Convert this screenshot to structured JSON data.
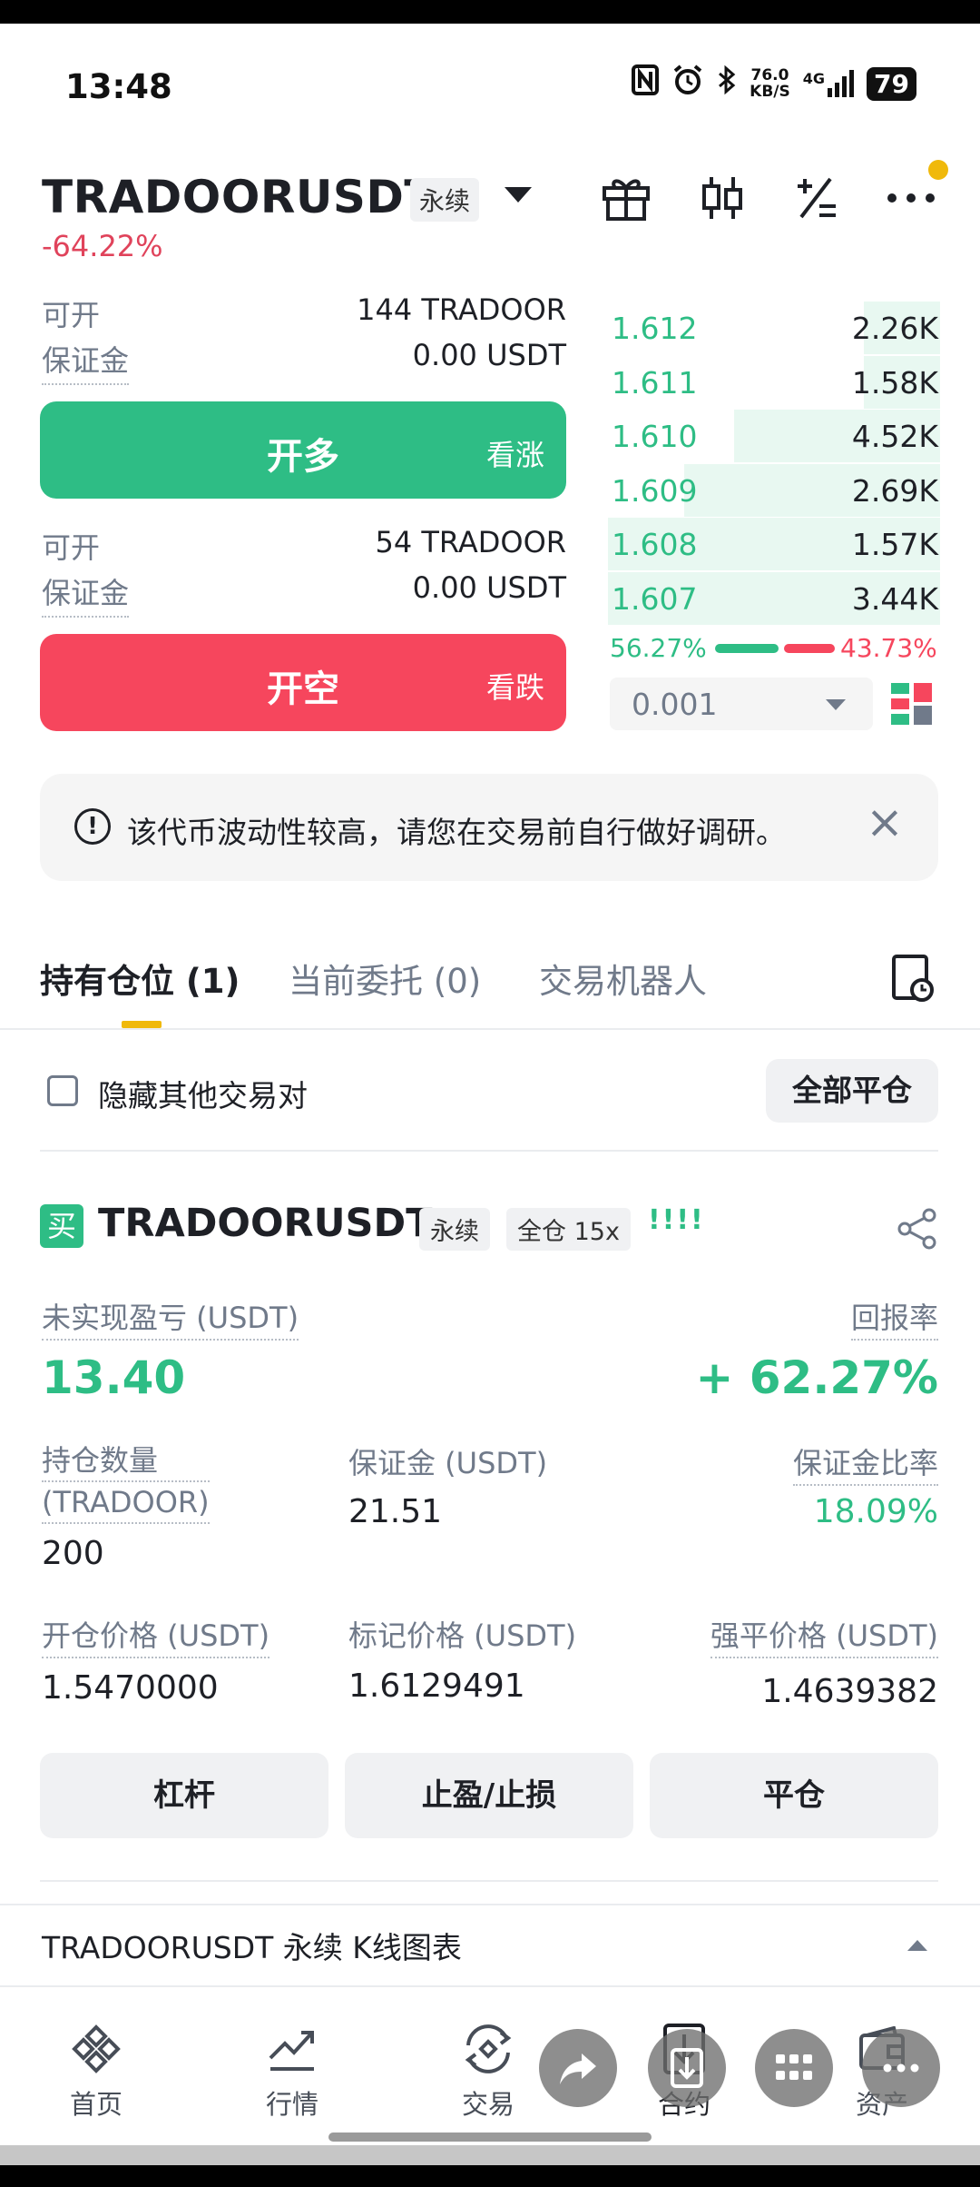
{
  "status": {
    "time": "13:48",
    "net_speed": "76.0",
    "net_unit": "KB/S",
    "signal": "4G",
    "battery": "79"
  },
  "header": {
    "symbol": "TRADOORUSDT",
    "contract_type": "永续",
    "change": "-64.22%"
  },
  "long_panel": {
    "available_label": "可开",
    "available_value": "144 TRADOOR",
    "margin_label": "保证金",
    "margin_value": "0.00 USDT",
    "button": "开多",
    "button_sub": "看涨"
  },
  "short_panel": {
    "available_label": "可开",
    "available_value": "54 TRADOOR",
    "margin_label": "保证金",
    "margin_value": "0.00 USDT",
    "button": "开空",
    "button_sub": "看跌"
  },
  "orderbook": {
    "rows": [
      {
        "price": "1.612",
        "qty": "2.26K",
        "depth": 0.23
      },
      {
        "price": "1.611",
        "qty": "1.58K",
        "depth": 0.23
      },
      {
        "price": "1.610",
        "qty": "4.52K",
        "depth": 0.62
      },
      {
        "price": "1.609",
        "qty": "2.69K",
        "depth": 0.77
      },
      {
        "price": "1.608",
        "qty": "1.57K",
        "depth": 1.0
      },
      {
        "price": "1.607",
        "qty": "3.44K",
        "depth": 1.0
      }
    ],
    "buy_ratio": "56.27%",
    "sell_ratio": "43.73%",
    "precision": "0.001"
  },
  "notice": {
    "text": "该代币波动性较高，请您在交易前自行做好调研。"
  },
  "tabs": [
    "持有仓位 (1)",
    "当前委托 (0)",
    "交易机器人"
  ],
  "positions_filter": {
    "hide_label": "隐藏其他交易对",
    "close_all": "全部平仓"
  },
  "position": {
    "side_badge": "买",
    "symbol": "TRADOORUSDT",
    "contract_type": "永续",
    "margin_mode": "全仓 15x",
    "signal": "!!!!",
    "pnl_label": "未实现盈亏 (USDT)",
    "pnl_value": "13.40",
    "roe_label": "回报率",
    "roe_value": "+ 62.27%",
    "size_label_1": "持仓数量",
    "size_label_2": "(TRADOOR)",
    "size_value": "200",
    "margin_label": "保证金 (USDT)",
    "margin_value": "21.51",
    "margin_ratio_label": "保证金比率",
    "margin_ratio_value": "18.09%",
    "entry_label": "开仓价格 (USDT)",
    "entry_value": "1.5470000",
    "mark_label": "标记价格 (USDT)",
    "mark_value": "1.6129491",
    "liq_label": "强平价格 (USDT)",
    "liq_value": "1.4639382",
    "btn_leverage": "杠杆",
    "btn_tpsl": "止盈/止损",
    "btn_close": "平仓"
  },
  "kline": {
    "title": "TRADOORUSDT 永续 K线图表"
  },
  "nav": [
    {
      "label": "首页",
      "icon": "binance-logo-icon"
    },
    {
      "label": "行情",
      "icon": "market-chart-icon"
    },
    {
      "label": "交易",
      "icon": "trade-icon"
    },
    {
      "label": "合约",
      "icon": "futures-icon"
    },
    {
      "label": "资产",
      "icon": "wallet-icon"
    }
  ],
  "colors": {
    "buy": "#2ebd85",
    "sell": "#f6465d",
    "accent": "#f0b90b"
  }
}
